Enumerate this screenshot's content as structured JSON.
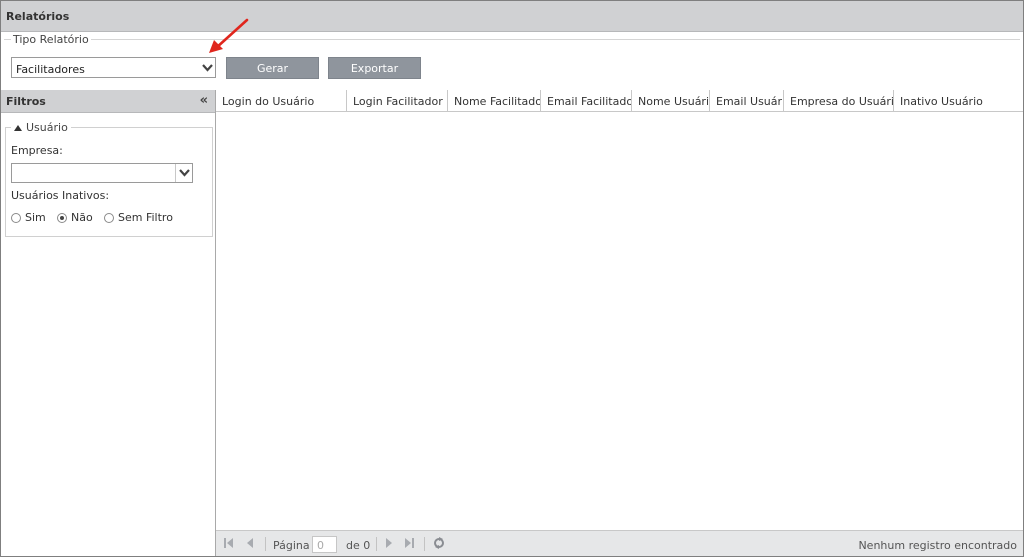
{
  "window": {
    "title": "Relatórios"
  },
  "report_type": {
    "legend": "Tipo Relatório",
    "selected": "Facilitadores",
    "generate_label": "Gerar",
    "export_label": "Exportar"
  },
  "filters": {
    "title": "Filtros",
    "collapse_glyph": "«",
    "user_group": {
      "legend": "Usuário",
      "company_label": "Empresa:",
      "company_value": "",
      "inactive_label": "Usuários Inativos:",
      "options": [
        "Sim",
        "Não",
        "Sem Filtro"
      ],
      "selected_option": "Não"
    }
  },
  "grid": {
    "columns": [
      "Login do Usuário",
      "Login Facilitador",
      "Nome Facilitador",
      "Email Facilitador",
      "Nome Usuário",
      "Email Usuário",
      "Empresa do Usuário",
      "Inativo Usuário"
    ],
    "rows": []
  },
  "pager": {
    "page_label": "Página",
    "page_value": "0",
    "of_label": "de 0",
    "status": "Nenhum registro encontrado"
  },
  "colors": {
    "header_bg": "#d0d1d3",
    "button_bg": "#8f959d",
    "annotation_arrow": "#e0261d"
  }
}
